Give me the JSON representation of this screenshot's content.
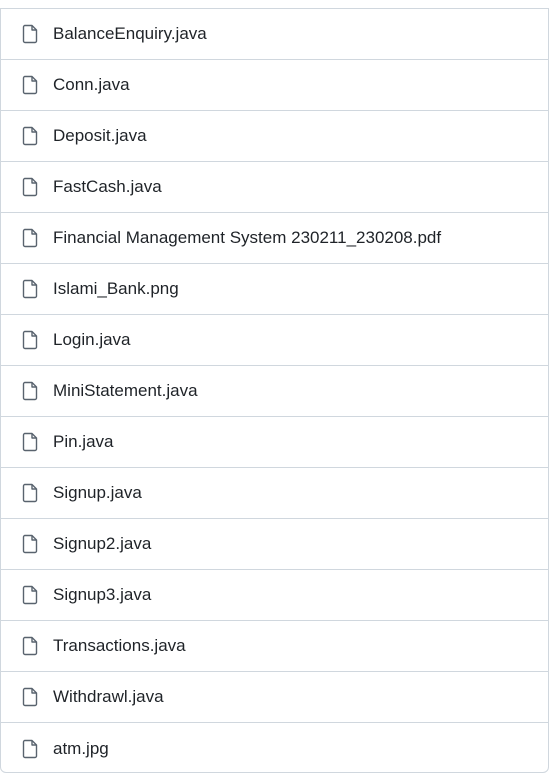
{
  "files": [
    {
      "name": "BalanceEnquiry.java",
      "icon": "file-icon"
    },
    {
      "name": "Conn.java",
      "icon": "file-icon"
    },
    {
      "name": "Deposit.java",
      "icon": "file-icon"
    },
    {
      "name": "FastCash.java",
      "icon": "file-icon"
    },
    {
      "name": "Financial Management System 230211_230208.pdf",
      "icon": "file-icon"
    },
    {
      "name": "Islami_Bank.png",
      "icon": "file-icon"
    },
    {
      "name": "Login.java",
      "icon": "file-icon"
    },
    {
      "name": "MiniStatement.java",
      "icon": "file-icon"
    },
    {
      "name": "Pin.java",
      "icon": "file-icon"
    },
    {
      "name": "Signup.java",
      "icon": "file-icon"
    },
    {
      "name": "Signup2.java",
      "icon": "file-icon"
    },
    {
      "name": "Signup3.java",
      "icon": "file-icon"
    },
    {
      "name": "Transactions.java",
      "icon": "file-icon"
    },
    {
      "name": "Withdrawl.java",
      "icon": "file-icon"
    },
    {
      "name": "atm.jpg",
      "icon": "file-icon"
    }
  ]
}
